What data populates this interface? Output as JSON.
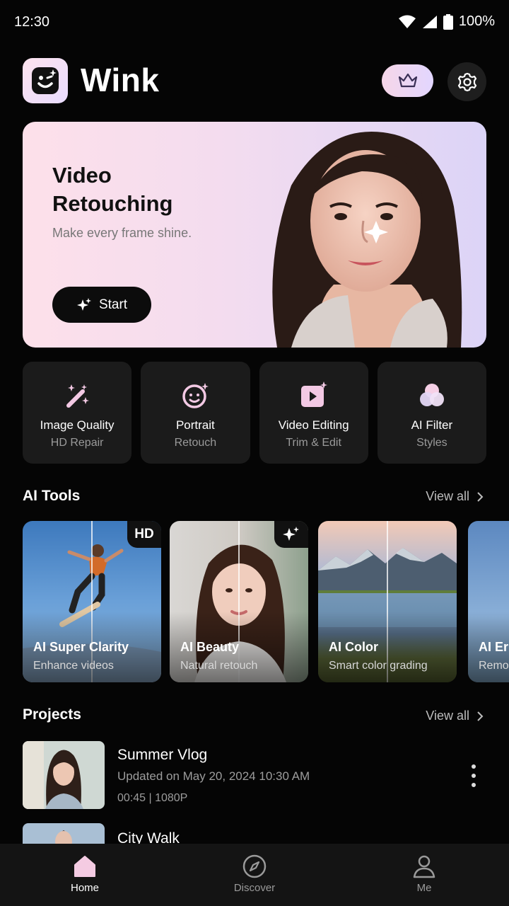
{
  "status_bar": {
    "time": "12:30",
    "battery": "100%"
  },
  "header": {
    "app_name": "Wink"
  },
  "hero": {
    "title": "Video Retouching",
    "subtitle": "Make every frame shine.",
    "button": "Start"
  },
  "features": [
    {
      "title": "Image Quality",
      "subtitle": "HD Repair",
      "icon": "magic-wand-icon"
    },
    {
      "title": "Portrait",
      "subtitle": "Retouch",
      "icon": "face-sparkle-icon"
    },
    {
      "title": "Video Editing",
      "subtitle": "Trim & Edit",
      "icon": "video-play-icon"
    },
    {
      "title": "AI Filter",
      "subtitle": "Styles",
      "icon": "color-circles-icon"
    }
  ],
  "ai_tools": {
    "title": "AI Tools",
    "view_all": "View all",
    "items": [
      {
        "name": "AI Super Clarity",
        "desc": "Enhance videos",
        "badge": "HD"
      },
      {
        "name": "AI Beauty",
        "desc": "Natural retouch",
        "badge": ""
      },
      {
        "name": "AI Color",
        "desc": "Smart color grading",
        "badge": ""
      },
      {
        "name": "AI Er",
        "desc": "Remo",
        "badge": ""
      }
    ]
  },
  "projects": {
    "title": "Projects",
    "view_all": "View all",
    "items": [
      {
        "name": "Summer Vlog",
        "updated": "Updated on May 20, 2024  10:30 AM",
        "meta": "00:45  |  1080P"
      },
      {
        "name": "City Walk",
        "updated": "",
        "meta": ""
      }
    ]
  },
  "nav": [
    {
      "label": "Home",
      "active": true
    },
    {
      "label": "Discover",
      "active": false
    },
    {
      "label": "Me",
      "active": false
    }
  ]
}
